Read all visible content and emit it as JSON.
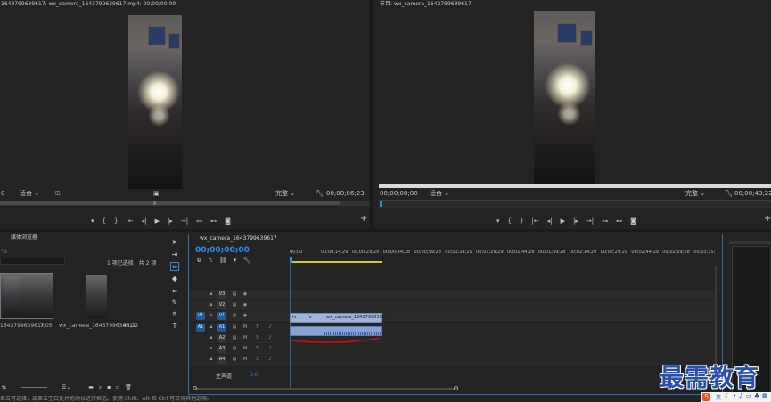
{
  "source_monitor": {
    "title": "1643799639617: wx_camera_1643799639617.mp4: 00;00;00;00",
    "fit_left": "0",
    "fit_label": "适合",
    "quality_label": "完整",
    "duration": "00;00;06;23"
  },
  "program_monitor": {
    "title": "节目: wx_camera_1643799639617",
    "timecode": "00;00;00;00",
    "fit_label": "适合",
    "quality_label": "完整",
    "duration": "00;00;43;22"
  },
  "transport_icons": [
    "marker-icon",
    "in-point-icon",
    "out-point-icon",
    "go-to-in-icon",
    "step-back-icon",
    "play-icon",
    "step-forward-icon",
    "go-to-out-icon",
    "insert-icon",
    "overwrite-icon",
    "camera-icon",
    "add-icon"
  ],
  "project": {
    "title": "媒体浏览器",
    "selection_count": "1 项已选择，共 2 项",
    "items": [
      {
        "name": "1643799639617",
        "duration": "7;05"
      },
      {
        "name": "wx_camera_1643799639617",
        "duration": "43;22"
      }
    ]
  },
  "timeline": {
    "tab": "wx_camera_1643799639617",
    "timecode": "00;00;00;00",
    "ruler_ticks": [
      "00;00",
      "00;00;14;29",
      "00;00;29;29",
      "00;00;44;28",
      "00;00;59;28",
      "00;01;14;29",
      "00;01;29;29",
      "00;01;44;28",
      "00;01;59;28",
      "00;02;14;29",
      "00;02;29;29",
      "00;02;44;29",
      "00;02;59;28",
      "00;03;15;"
    ],
    "video_tracks": [
      {
        "patch": "",
        "name": "V3"
      },
      {
        "patch": "",
        "name": "V2"
      },
      {
        "patch": "V1",
        "name": "V1"
      }
    ],
    "audio_tracks": [
      {
        "patch": "A1",
        "name": "A1",
        "m": "M",
        "s": "S"
      },
      {
        "patch": "",
        "name": "A2",
        "m": "M",
        "s": "S"
      },
      {
        "patch": "",
        "name": "A3",
        "m": "M",
        "s": "S"
      },
      {
        "patch": "",
        "name": "A4",
        "m": "M",
        "s": "S"
      }
    ],
    "master": {
      "label": "主声道",
      "value": "0.0"
    },
    "video_clip_label": "wx_camera_1643799639617",
    "video_clip_fx": "fx"
  },
  "status_bar": "单击可选择，或单击空白处并拖动以进行框选。使用 Shift、Alt 和 Ctrl 可获得其他选项。",
  "watermark": "最需教育",
  "tray": {
    "ime_icon": "sogou-icon",
    "ime_label": "英",
    "icons": [
      "moon-icon",
      "dot-icon",
      "mic-icon",
      "keyboard-icon",
      "shirt-icon",
      "grid-icon"
    ]
  },
  "colors": {
    "accent": "#2d8ceb",
    "timeline_bar": "#d6c81e",
    "annotation": "#d01010",
    "watermark": "#2a4fa8"
  }
}
